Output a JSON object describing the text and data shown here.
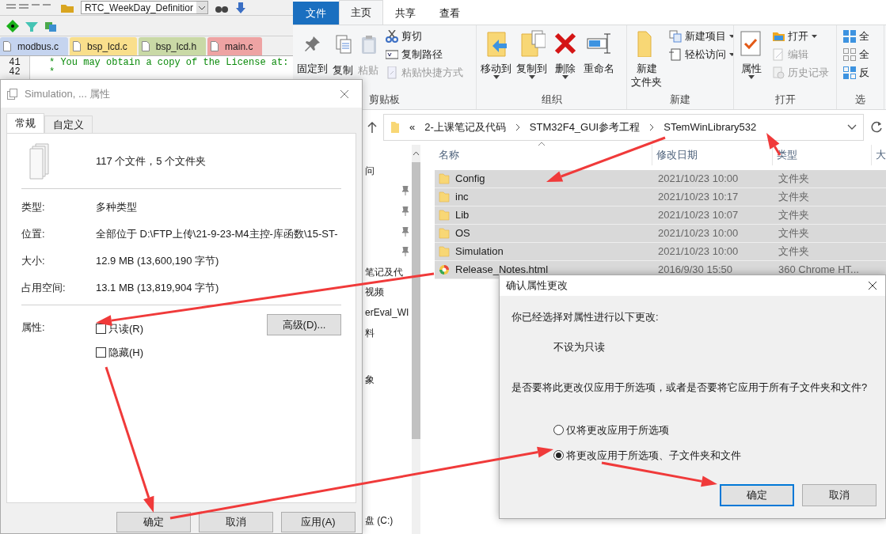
{
  "editor": {
    "function_combo": "RTC_WeekDay_Definitior",
    "tabs": [
      {
        "label": "modbus.c",
        "color": "#c5d4ef"
      },
      {
        "label": "bsp_lcd.c",
        "color": "#f9df8c"
      },
      {
        "label": "bsp_lcd.h",
        "color": "#c9d9a6"
      },
      {
        "label": "main.c",
        "color": "#eea3a3"
      }
    ],
    "code_lines": [
      {
        "number": "41",
        "text": "* You may obtain a copy of the License at:"
      },
      {
        "number": "42",
        "text": "*"
      }
    ]
  },
  "explorer": {
    "ribbon_tabs": [
      {
        "label": "文件",
        "kind": "file",
        "selected": false
      },
      {
        "label": "主页",
        "kind": "tab",
        "selected": true
      },
      {
        "label": "共享",
        "kind": "tab",
        "selected": false
      },
      {
        "label": "查看",
        "kind": "tab",
        "selected": false
      }
    ],
    "ribbon_groups": [
      {
        "label": "剪贴板",
        "items": [
          {
            "label": "固定到",
            "kind": "large",
            "disabled": false,
            "dropdown": false
          },
          {
            "label": "复制",
            "kind": "large",
            "disabled": false,
            "dropdown": false
          },
          {
            "label": "粘贴",
            "kind": "large",
            "disabled": true,
            "dropdown": false
          },
          {
            "label": "剪切",
            "kind": "small",
            "disabled": false,
            "dropdown": false
          },
          {
            "label": "复制路径",
            "kind": "small",
            "disabled": false,
            "dropdown": false
          },
          {
            "label": "粘贴快捷方式",
            "kind": "small",
            "disabled": true,
            "dropdown": false
          }
        ]
      },
      {
        "label": "组织",
        "items": [
          {
            "label": "移动到",
            "kind": "large",
            "disabled": false,
            "dropdown": true
          },
          {
            "label": "复制到",
            "kind": "large",
            "disabled": false,
            "dropdown": true
          },
          {
            "label": "删除",
            "kind": "large",
            "disabled": false,
            "dropdown": true
          },
          {
            "label": "重命名",
            "kind": "large",
            "disabled": false,
            "dropdown": false
          }
        ]
      },
      {
        "label": "新建",
        "items": [
          {
            "label": [
              "新建",
              "文件夹"
            ],
            "kind": "large",
            "disabled": false,
            "dropdown": false
          },
          {
            "label": "新建项目",
            "kind": "small",
            "disabled": false,
            "dropdown": true
          },
          {
            "label": "轻松访问",
            "kind": "small",
            "disabled": false,
            "dropdown": true
          }
        ]
      },
      {
        "label": "打开",
        "items": [
          {
            "label": "属性",
            "kind": "large",
            "disabled": false,
            "dropdown": true
          },
          {
            "label": "打开",
            "kind": "small",
            "disabled": false,
            "dropdown": true
          },
          {
            "label": "编辑",
            "kind": "small",
            "disabled": true,
            "dropdown": false
          },
          {
            "label": "历史记录",
            "kind": "small",
            "disabled": true,
            "dropdown": false
          }
        ]
      },
      {
        "label": "选",
        "items": [
          {
            "label": "全",
            "kind": "small",
            "disabled": false,
            "dropdown": false
          },
          {
            "label": "全",
            "kind": "small",
            "disabled": false,
            "dropdown": false
          },
          {
            "label": "反",
            "kind": "small",
            "disabled": false,
            "dropdown": false
          }
        ]
      }
    ],
    "address": {
      "prefix": "«",
      "parts": [
        "2-上课笔记及代码",
        "STM32F4_GUI参考工程",
        "STemWinLibrary532"
      ]
    },
    "nav_items": [
      {
        "label": "问",
        "pinned": false
      },
      {
        "pinned": true
      },
      {
        "pinned": true
      },
      {
        "pinned": true
      },
      {
        "pinned": true
      },
      {
        "label": "笔记及代",
        "pinned": false
      },
      {
        "label": "视频",
        "pinned": false
      },
      {
        "label": "erEval_WI",
        "pinned": false
      },
      {
        "label": "料",
        "pinned": false
      },
      {
        "label": "象",
        "pinned": false
      },
      {
        "label": "盘 (C:)",
        "pinned": false
      }
    ],
    "columns": [
      "名称",
      "修改日期",
      "类型",
      "大"
    ],
    "files": [
      {
        "name": "Config",
        "date": "2021/10/23 10:00",
        "type": "文件夹",
        "kind": "folder",
        "selected": true
      },
      {
        "name": "inc",
        "date": "2021/10/23 10:17",
        "type": "文件夹",
        "kind": "folder",
        "selected": true
      },
      {
        "name": "Lib",
        "date": "2021/10/23 10:07",
        "type": "文件夹",
        "kind": "folder",
        "selected": true
      },
      {
        "name": "OS",
        "date": "2021/10/23 10:00",
        "type": "文件夹",
        "kind": "folder",
        "selected": true
      },
      {
        "name": "Simulation",
        "date": "2021/10/23 10:00",
        "type": "文件夹",
        "kind": "folder",
        "selected": true
      },
      {
        "name": "Release_Notes.html",
        "date": "2016/9/30 15:50",
        "type": "360 Chrome HT...",
        "kind": "html",
        "selected": true
      }
    ]
  },
  "properties_dialog": {
    "title": "Simulation, ... 属性",
    "tabs": [
      {
        "label": "常规",
        "selected": true
      },
      {
        "label": "自定义",
        "selected": false
      }
    ],
    "summary": "117 个文件，5 个文件夹",
    "fields": [
      {
        "label": "类型:",
        "value": "多种类型"
      },
      {
        "label": "位置:",
        "value": "全部位于 D:\\FTP上传\\21-9-23-M4主控-库函数\\15-ST-"
      },
      {
        "label": "大小:",
        "value": "12.9 MB (13,600,190 字节)"
      },
      {
        "label": "占用空间:",
        "value": "13.1 MB (13,819,904 字节)"
      }
    ],
    "attributes_label": "属性:",
    "attributes": [
      {
        "label": "只读(R)",
        "checked": false
      },
      {
        "label": "隐藏(H)",
        "checked": false
      }
    ],
    "advanced_button": "高级(D)...",
    "buttons": [
      "确定",
      "取消",
      "应用(A)"
    ]
  },
  "confirm_dialog": {
    "title": "确认属性更改",
    "intro": "你已经选择对属性进行以下更改:",
    "change": "不设为只读",
    "question": "是否要将此更改仅应用于所选项，或者是否要将它应用于所有子文件夹和文件?",
    "options": [
      {
        "label": "仅将更改应用于所选项",
        "selected": false
      },
      {
        "label": "将更改应用于所选项、子文件夹和文件",
        "selected": true
      }
    ],
    "buttons": [
      {
        "label": "确定",
        "default": true
      },
      {
        "label": "取消",
        "default": false
      }
    ]
  }
}
